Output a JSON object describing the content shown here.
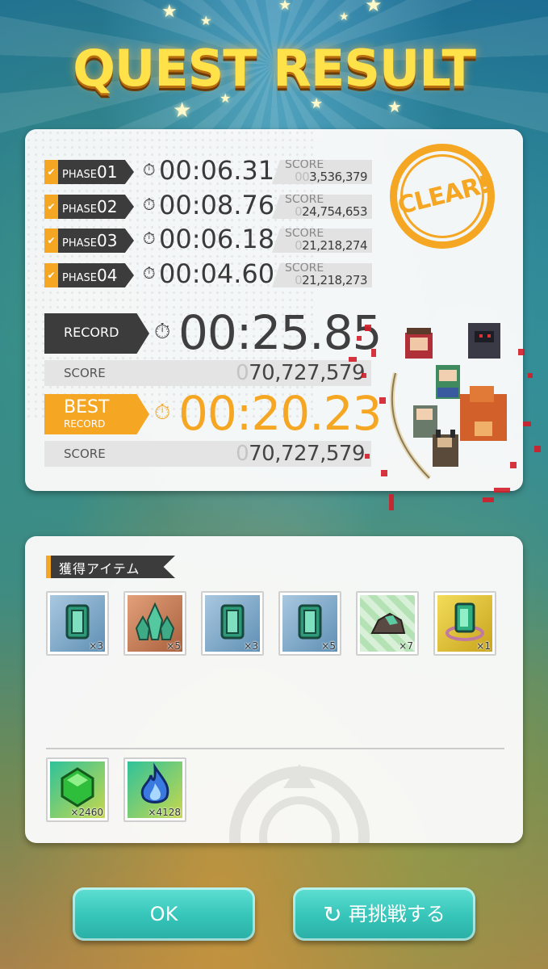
{
  "title": "QUEST RESULT",
  "phases": [
    {
      "label": "PHASE",
      "num": "01",
      "time": "00:06.31",
      "score_label": "SCORE",
      "score_lead": "00",
      "score_value": "3,536,379"
    },
    {
      "label": "PHASE",
      "num": "02",
      "time": "00:08.76",
      "score_label": "SCORE",
      "score_lead": "0",
      "score_value": "24,754,653"
    },
    {
      "label": "PHASE",
      "num": "03",
      "time": "00:06.18",
      "score_label": "SCORE",
      "score_lead": "0",
      "score_value": "21,218,274"
    },
    {
      "label": "PHASE",
      "num": "04",
      "time": "00:04.60",
      "score_label": "SCORE",
      "score_lead": "0",
      "score_value": "21,218,273"
    }
  ],
  "record": {
    "label": "RECORD",
    "time": "00:25.85",
    "score_label": "SCORE",
    "score_lead": "0",
    "score_value": "70,727,579"
  },
  "best": {
    "label": "BEST",
    "sublabel": "RECORD",
    "time": "00:20.23",
    "score_label": "SCORE",
    "score_lead": "0",
    "score_value": "70,727,579"
  },
  "stamp": "CLEAR!",
  "items_header": "獲得アイテム",
  "items": [
    {
      "icon": "emerald-ticket-icon",
      "count": "×3",
      "bg": "#7ea9c9"
    },
    {
      "icon": "green-crystal-cluster-icon",
      "count": "×5",
      "bg": "#c57a4e"
    },
    {
      "icon": "emerald-ticket-icon",
      "count": "×3",
      "bg": "#7ea9c9"
    },
    {
      "icon": "emerald-ticket-icon",
      "count": "×5",
      "bg": "#7ea9c9"
    },
    {
      "icon": "ore-rock-icon",
      "count": "×7",
      "bg": "#bfe6bf"
    },
    {
      "icon": "crystal-ring-icon",
      "count": "×1",
      "bg": "#e2c43c"
    }
  ],
  "currencies": [
    {
      "icon": "green-gem-icon",
      "count": "×2460"
    },
    {
      "icon": "blue-flame-icon",
      "count": "×4128"
    }
  ],
  "buttons": {
    "ok": "OK",
    "retry": "再挑戦する"
  },
  "colors": {
    "accent": "#f5a623",
    "dark_tag": "#3c3c3c",
    "button": "#36c4b9"
  }
}
